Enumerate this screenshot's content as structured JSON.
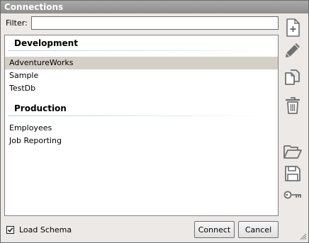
{
  "window": {
    "title": "Connections"
  },
  "filter": {
    "label": "Filter:",
    "value": ""
  },
  "groups": [
    {
      "name": "Development",
      "items": [
        "AdventureWorks",
        "Sample",
        "TestDb"
      ]
    },
    {
      "name": "Production",
      "items": [
        "Employees",
        "Job Reporting"
      ]
    }
  ],
  "selected_item": "AdventureWorks",
  "toolbar": {
    "icons": [
      "new-connection-icon",
      "edit-icon",
      "copy-icon",
      "delete-icon",
      "open-folder-icon",
      "save-icon",
      "key-icon"
    ]
  },
  "footer": {
    "load_schema_label": "Load Schema",
    "load_schema_checked": true,
    "connect_label": "Connect",
    "cancel_label": "Cancel"
  },
  "colors": {
    "title_bar": "#999999",
    "selection": "#d4d0c8",
    "icon": "#707070"
  }
}
